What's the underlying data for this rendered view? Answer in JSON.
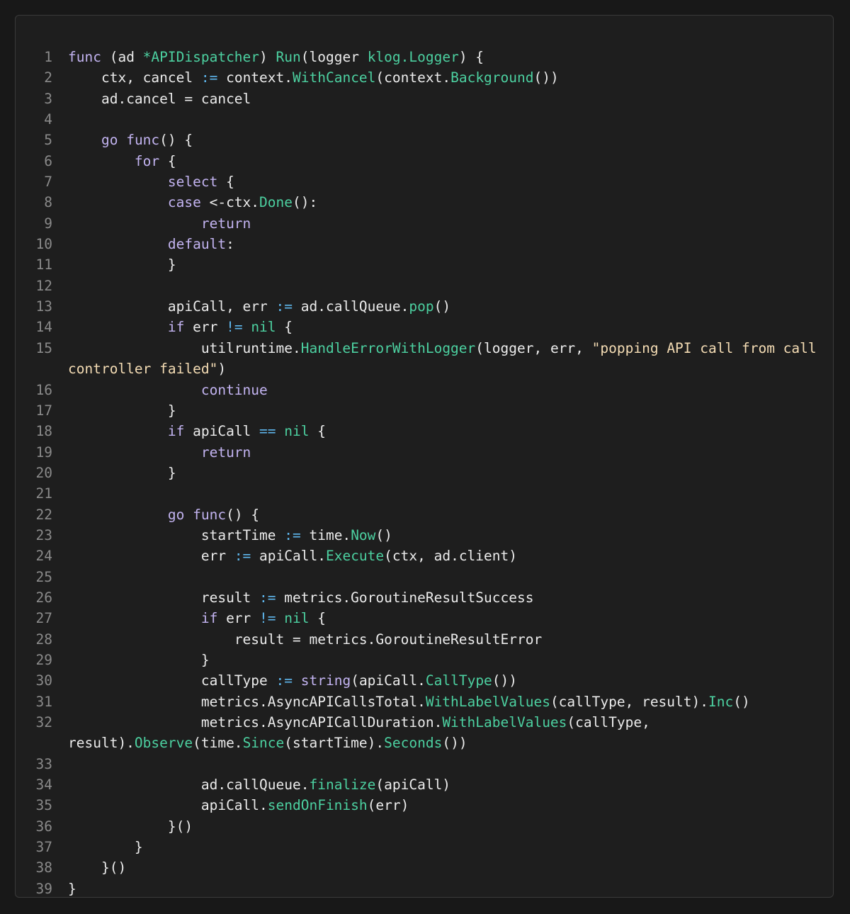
{
  "code": {
    "language": "go",
    "lines": [
      [
        {
          "t": "kw",
          "s": "func"
        },
        {
          "t": "",
          "s": " (ad "
        },
        {
          "t": "fn",
          "s": "*APIDispatcher"
        },
        {
          "t": "",
          "s": ") "
        },
        {
          "t": "fn",
          "s": "Run"
        },
        {
          "t": "",
          "s": "(logger "
        },
        {
          "t": "fn",
          "s": "klog.Logger"
        },
        {
          "t": "",
          "s": ") {"
        }
      ],
      [
        {
          "t": "",
          "s": "    ctx, cancel "
        },
        {
          "t": "op",
          "s": ":="
        },
        {
          "t": "",
          "s": " context."
        },
        {
          "t": "fn",
          "s": "WithCancel"
        },
        {
          "t": "",
          "s": "(context."
        },
        {
          "t": "fn",
          "s": "Background"
        },
        {
          "t": "",
          "s": "())"
        }
      ],
      [
        {
          "t": "",
          "s": "    ad.cancel = cancel"
        }
      ],
      [],
      [
        {
          "t": "",
          "s": "    "
        },
        {
          "t": "kw",
          "s": "go"
        },
        {
          "t": "",
          "s": " "
        },
        {
          "t": "kw",
          "s": "func"
        },
        {
          "t": "",
          "s": "() {"
        }
      ],
      [
        {
          "t": "",
          "s": "        "
        },
        {
          "t": "kw",
          "s": "for"
        },
        {
          "t": "",
          "s": " {"
        }
      ],
      [
        {
          "t": "",
          "s": "            "
        },
        {
          "t": "kw",
          "s": "select"
        },
        {
          "t": "",
          "s": " {"
        }
      ],
      [
        {
          "t": "",
          "s": "            "
        },
        {
          "t": "kw",
          "s": "case"
        },
        {
          "t": "",
          "s": " <-ctx."
        },
        {
          "t": "fn",
          "s": "Done"
        },
        {
          "t": "",
          "s": "():"
        }
      ],
      [
        {
          "t": "",
          "s": "                "
        },
        {
          "t": "kw",
          "s": "return"
        }
      ],
      [
        {
          "t": "",
          "s": "            "
        },
        {
          "t": "kw",
          "s": "default"
        },
        {
          "t": "",
          "s": ":"
        }
      ],
      [
        {
          "t": "",
          "s": "            }"
        }
      ],
      [],
      [
        {
          "t": "",
          "s": "            apiCall, err "
        },
        {
          "t": "op",
          "s": ":="
        },
        {
          "t": "",
          "s": " ad.callQueue."
        },
        {
          "t": "fn",
          "s": "pop"
        },
        {
          "t": "",
          "s": "()"
        }
      ],
      [
        {
          "t": "",
          "s": "            "
        },
        {
          "t": "kw",
          "s": "if"
        },
        {
          "t": "",
          "s": " err "
        },
        {
          "t": "op",
          "s": "!="
        },
        {
          "t": "",
          "s": " "
        },
        {
          "t": "fn",
          "s": "nil"
        },
        {
          "t": "",
          "s": " {"
        }
      ],
      [
        {
          "t": "",
          "s": "                utilruntime."
        },
        {
          "t": "fn",
          "s": "HandleErrorWithLogger"
        },
        {
          "t": "",
          "s": "(logger, err, "
        },
        {
          "t": "str",
          "s": "\"popping API call from call controller failed\""
        },
        {
          "t": "",
          "s": ")"
        }
      ],
      [
        {
          "t": "",
          "s": "                "
        },
        {
          "t": "kw",
          "s": "continue"
        }
      ],
      [
        {
          "t": "",
          "s": "            }"
        }
      ],
      [
        {
          "t": "",
          "s": "            "
        },
        {
          "t": "kw",
          "s": "if"
        },
        {
          "t": "",
          "s": " apiCall "
        },
        {
          "t": "op",
          "s": "=="
        },
        {
          "t": "",
          "s": " "
        },
        {
          "t": "fn",
          "s": "nil"
        },
        {
          "t": "",
          "s": " {"
        }
      ],
      [
        {
          "t": "",
          "s": "                "
        },
        {
          "t": "kw",
          "s": "return"
        }
      ],
      [
        {
          "t": "",
          "s": "            }"
        }
      ],
      [],
      [
        {
          "t": "",
          "s": "            "
        },
        {
          "t": "kw",
          "s": "go"
        },
        {
          "t": "",
          "s": " "
        },
        {
          "t": "kw",
          "s": "func"
        },
        {
          "t": "",
          "s": "() {"
        }
      ],
      [
        {
          "t": "",
          "s": "                startTime "
        },
        {
          "t": "op",
          "s": ":="
        },
        {
          "t": "",
          "s": " time."
        },
        {
          "t": "fn",
          "s": "Now"
        },
        {
          "t": "",
          "s": "()"
        }
      ],
      [
        {
          "t": "",
          "s": "                err "
        },
        {
          "t": "op",
          "s": ":="
        },
        {
          "t": "",
          "s": " apiCall."
        },
        {
          "t": "fn",
          "s": "Execute"
        },
        {
          "t": "",
          "s": "(ctx, ad.client)"
        }
      ],
      [],
      [
        {
          "t": "",
          "s": "                result "
        },
        {
          "t": "op",
          "s": ":="
        },
        {
          "t": "",
          "s": " metrics.GoroutineResultSuccess"
        }
      ],
      [
        {
          "t": "",
          "s": "                "
        },
        {
          "t": "kw",
          "s": "if"
        },
        {
          "t": "",
          "s": " err "
        },
        {
          "t": "op",
          "s": "!="
        },
        {
          "t": "",
          "s": " "
        },
        {
          "t": "fn",
          "s": "nil"
        },
        {
          "t": "",
          "s": " {"
        }
      ],
      [
        {
          "t": "",
          "s": "                    result = metrics.GoroutineResultError"
        }
      ],
      [
        {
          "t": "",
          "s": "                }"
        }
      ],
      [
        {
          "t": "",
          "s": "                callType "
        },
        {
          "t": "op",
          "s": ":="
        },
        {
          "t": "",
          "s": " "
        },
        {
          "t": "kw",
          "s": "string"
        },
        {
          "t": "",
          "s": "(apiCall."
        },
        {
          "t": "fn",
          "s": "CallType"
        },
        {
          "t": "",
          "s": "())"
        }
      ],
      [
        {
          "t": "",
          "s": "                metrics.AsyncAPICallsTotal."
        },
        {
          "t": "fn",
          "s": "WithLabelValues"
        },
        {
          "t": "",
          "s": "(callType, result)."
        },
        {
          "t": "fn",
          "s": "Inc"
        },
        {
          "t": "",
          "s": "()"
        }
      ],
      [
        {
          "t": "",
          "s": "                metrics.AsyncAPICallDuration."
        },
        {
          "t": "fn",
          "s": "WithLabelValues"
        },
        {
          "t": "",
          "s": "(callType, result)."
        },
        {
          "t": "fn",
          "s": "Observe"
        },
        {
          "t": "",
          "s": "(time."
        },
        {
          "t": "fn",
          "s": "Since"
        },
        {
          "t": "",
          "s": "(startTime)."
        },
        {
          "t": "fn",
          "s": "Seconds"
        },
        {
          "t": "",
          "s": "())"
        }
      ],
      [],
      [
        {
          "t": "",
          "s": "                ad.callQueue."
        },
        {
          "t": "fn",
          "s": "finalize"
        },
        {
          "t": "",
          "s": "(apiCall)"
        }
      ],
      [
        {
          "t": "",
          "s": "                apiCall."
        },
        {
          "t": "fn",
          "s": "sendOnFinish"
        },
        {
          "t": "",
          "s": "(err)"
        }
      ],
      [
        {
          "t": "",
          "s": "            }()"
        }
      ],
      [
        {
          "t": "",
          "s": "        }"
        }
      ],
      [
        {
          "t": "",
          "s": "    }()"
        }
      ],
      [
        {
          "t": "",
          "s": "}"
        }
      ]
    ]
  }
}
